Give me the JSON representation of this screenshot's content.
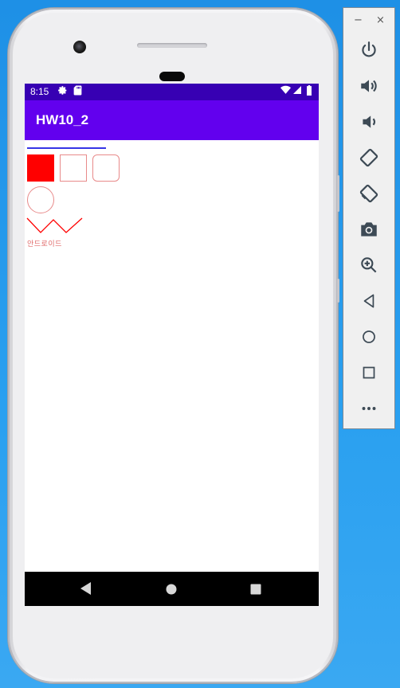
{
  "status_bar": {
    "time": "8:15",
    "icons": [
      "settings-icon",
      "sd-card-icon",
      "wifi-icon",
      "signal-icon",
      "battery-icon"
    ]
  },
  "app_bar": {
    "title": "HW10_2",
    "color": "#6200ee",
    "status_color": "#3700b3"
  },
  "content": {
    "shapes": [
      "blue-line",
      "filled-red-rectangle",
      "outline-rectangle",
      "rounded-outline-rectangle",
      "outline-circle",
      "red-zigzag-line"
    ],
    "text": "안드로이드",
    "colors": {
      "red": "#ff0000",
      "blue": "#3535e6",
      "outline": "#e88a8a"
    }
  },
  "nav_bar": {
    "buttons": [
      "back-icon",
      "home-icon",
      "recents-icon"
    ]
  },
  "emulator_toolbar": {
    "window_controls": {
      "minimize": "−",
      "close": "×"
    },
    "buttons": [
      "power-icon",
      "volume-up-icon",
      "volume-down-icon",
      "rotate-left-icon",
      "rotate-right-icon",
      "camera-icon",
      "zoom-icon",
      "back-icon",
      "home-icon",
      "overview-icon",
      "more-icon"
    ]
  }
}
